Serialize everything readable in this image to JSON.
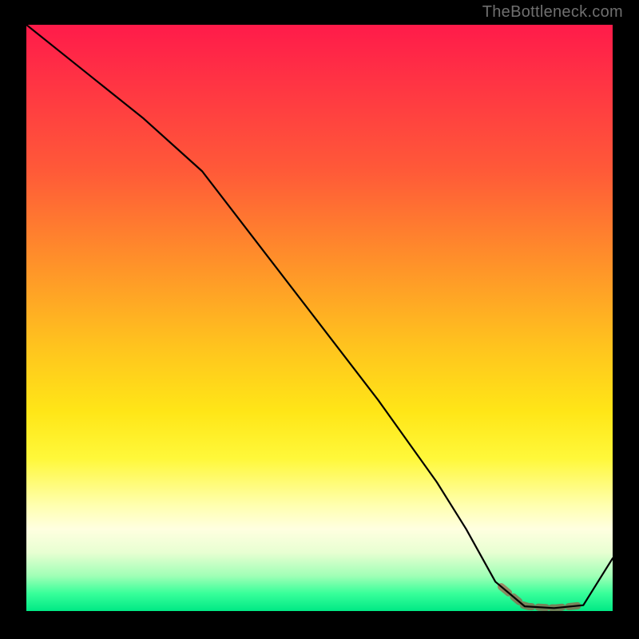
{
  "watermark": "TheBottleneck.com",
  "chart_data": {
    "type": "line",
    "title": "",
    "xlabel": "",
    "ylabel": "",
    "xlim": [
      0,
      100
    ],
    "ylim": [
      0,
      100
    ],
    "x": [
      0,
      10,
      20,
      30,
      40,
      50,
      60,
      70,
      75,
      80,
      85,
      90,
      95,
      100
    ],
    "values": [
      100,
      92,
      84,
      75,
      62,
      49,
      36,
      22,
      14,
      5,
      0.8,
      0.5,
      1.0,
      9
    ],
    "highlight_region_x": [
      81,
      94
    ],
    "annotations": [],
    "notes": "Curve descends from top-left, near-linear with a slight knee around x≈30, reaches ~0 near x≈85–90, then rises toward bottom-right. Dashed red segment marks the minimum trough."
  },
  "colors": {
    "gradient_top": "#ff1b4a",
    "gradient_mid": "#ffe617",
    "gradient_bottom": "#00e985",
    "curve": "#000000",
    "highlight": "#c93238"
  }
}
